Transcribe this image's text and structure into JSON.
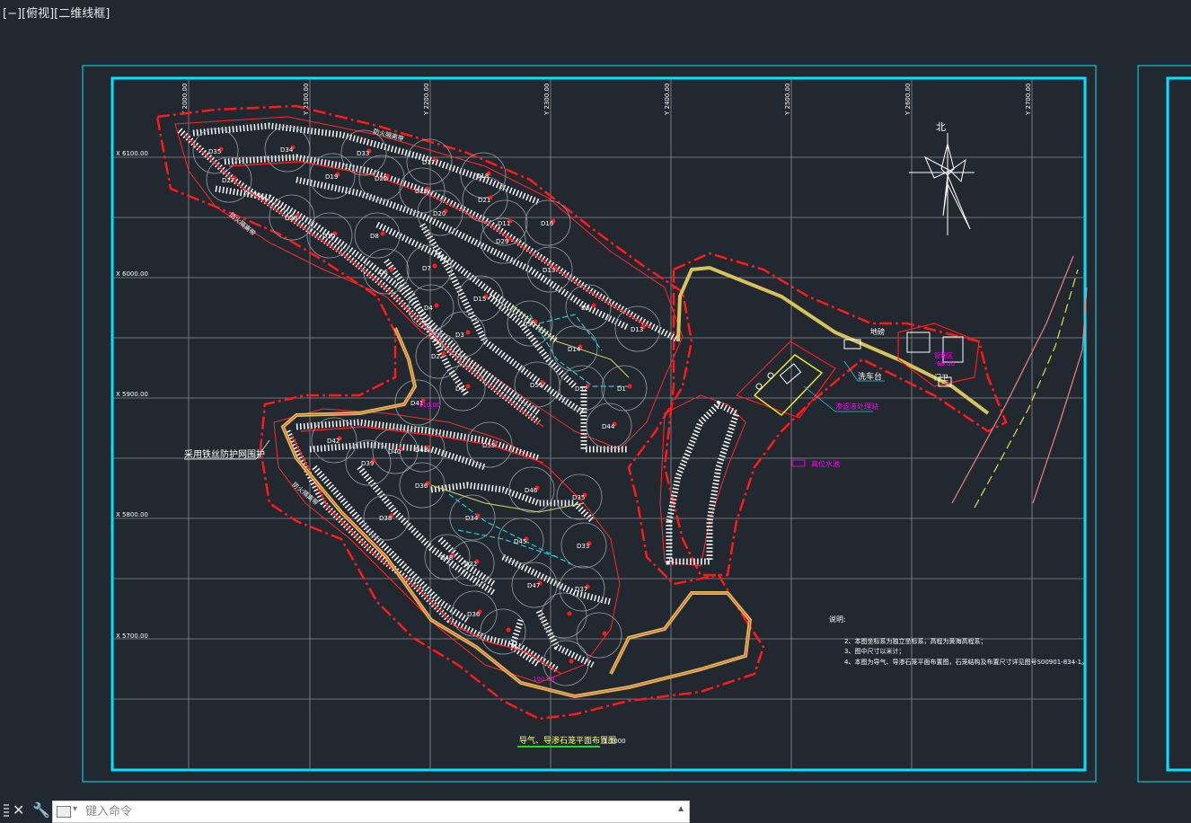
{
  "viewport": {
    "label": "[−][俯视][二维线框]"
  },
  "drawing": {
    "grid_y_labels": [
      "Y 2000.00",
      "Y 2100.00",
      "Y 2200.00",
      "Y 2300.00",
      "Y 2400.00",
      "Y 2500.00",
      "Y 2600.00",
      "Y 2700.00"
    ],
    "grid_x_labels": [
      "X 6100.00",
      "X 6000.00",
      "X 5900.00",
      "X 5800.00",
      "X 5700.00"
    ],
    "north_label": "北",
    "mine_labels": [
      "D35",
      "D34",
      "D33",
      "D17",
      "D18",
      "D19",
      "D22",
      "D29",
      "D21",
      "D27",
      "D28",
      "D20",
      "D11",
      "D16",
      "D10",
      "D8",
      "D29",
      "D13",
      "D6",
      "D7",
      "D15",
      "D5",
      "D4",
      "D13",
      "D3",
      "D50",
      "D14",
      "D2",
      "D51",
      "D1",
      "D4",
      "D52",
      "D44",
      "D41",
      "D43",
      "D53",
      "D40",
      "D42",
      "D39",
      "D36",
      "D46",
      "D35",
      "D34",
      "D45",
      "D33",
      "D38",
      "D32",
      "D48",
      "D47",
      "D37",
      "D36"
    ],
    "annotations": {
      "wire_fence": "采用铁丝防护网围护",
      "fire_road_1": "防火隔离带",
      "fire_road_2": "防火隔离带",
      "fire_road_3": "防火隔离带",
      "car_wash": "洗车台",
      "leachate": "渗滤液处理站",
      "pool": "高位水池",
      "office": "管理区",
      "gate": "门卫",
      "bridge": "地磅",
      "elev_1": "66.00",
      "elev_2": "110.00",
      "elev_3": "100.00"
    },
    "notes": {
      "heading": "说明:",
      "lines": [
        "2、本图坐标系为独立坐标系，高程为黄海高程系；",
        "3、图中尺寸以米计；",
        "4、本图为导气、导渗石笼平面布置图，石笼结构及布置尺寸详见图号S00901-834-1。"
      ]
    },
    "title": "导气、导渗石笼平面布置图",
    "scale": "1:1000"
  },
  "command": {
    "placeholder": "键入命令"
  },
  "colors": {
    "background": "#212830",
    "frame_cyan": "#00e5ff",
    "grid": "#8c8f94",
    "boundary_red": "#ff1a1a",
    "magenta": "#ff00ff",
    "road_yellow": "#d8c25a"
  }
}
